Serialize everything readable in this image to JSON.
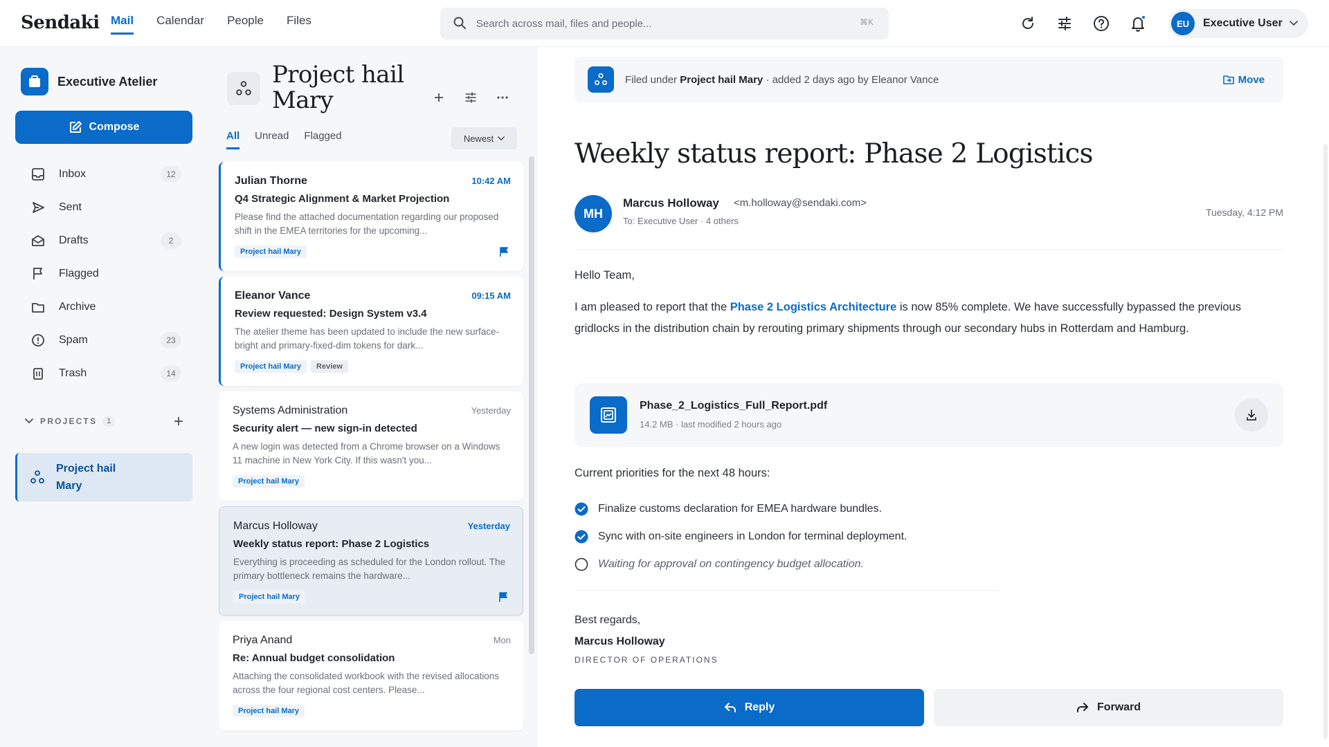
{
  "app": {
    "brand": "Sendaki",
    "nav": [
      "Mail",
      "Calendar",
      "People",
      "Files"
    ],
    "search": {
      "placeholder": "Search across mail, files and people...",
      "shortcut": "⌘K"
    },
    "user": {
      "initials": "EU",
      "name": "Executive User"
    }
  },
  "sidebar": {
    "workspace": "Executive Atelier",
    "compose_label": "Compose",
    "folders": [
      {
        "label": "Inbox",
        "count": "12",
        "icon": "inbox-icon"
      },
      {
        "label": "Sent",
        "count": "",
        "icon": "send-icon"
      },
      {
        "label": "Drafts",
        "count": "2",
        "icon": "drafts-icon"
      },
      {
        "label": "Flagged",
        "count": "",
        "icon": "flag-icon"
      },
      {
        "label": "Archive",
        "count": "",
        "icon": "archive-icon"
      },
      {
        "label": "Spam",
        "count": "23",
        "icon": "spam-icon"
      },
      {
        "label": "Trash",
        "count": "14",
        "icon": "trash-icon"
      }
    ],
    "projects_label": "PROJECTS",
    "projects_count": "1",
    "projects": [
      {
        "label": "Project hail Mary"
      }
    ]
  },
  "list": {
    "title": "Project hail Mary",
    "tabs": [
      "All",
      "Unread",
      "Flagged"
    ],
    "sort_label": "Newest",
    "cards": [
      {
        "sender": "Julian Thorne",
        "time": "10:42 AM",
        "subject": "Q4 Strategic Alignment & Market Projection",
        "preview": "Please find the attached documentation regarding our proposed shift in the EMEA territories for the upcoming...",
        "tags": [
          "Project hail Mary"
        ],
        "flagged": true
      },
      {
        "sender": "Eleanor Vance",
        "time": "09:15 AM",
        "subject": "Review requested: Design System v3.4",
        "preview": "The atelier theme has been updated to include the new surface-bright and primary-fixed-dim tokens for dark...",
        "tags": [
          "Project hail Mary",
          "Review"
        ],
        "flagged": false
      },
      {
        "sender": "Systems Administration",
        "time": "Yesterday",
        "subject": "Security alert — new sign-in detected",
        "preview": "A new login was detected from a Chrome browser on a Windows 11 machine in New York City. If this wasn't you...",
        "tags": [
          "Project hail Mary"
        ],
        "flagged": false
      },
      {
        "sender": "Marcus Holloway",
        "time": "Yesterday",
        "subject": "Weekly status report: Phase 2 Logistics",
        "preview": "Everything is proceeding as scheduled for the London rollout. The primary bottleneck remains the hardware...",
        "tags": [
          "Project hail Mary"
        ],
        "flagged": true
      },
      {
        "sender": "Priya Anand",
        "time": "Mon",
        "subject": "Re: Annual budget consolidation",
        "preview": "Attaching the consolidated workbook with the revised allocations across the four regional cost centers. Please...",
        "tags": [
          "Project hail Mary"
        ],
        "flagged": false
      }
    ]
  },
  "reader": {
    "filed": {
      "prefix": "Filed under",
      "project": "Project hail Mary",
      "suffix": "· added 2 days ago by Eleanor Vance",
      "move_label": "Move"
    },
    "title": "Weekly status report: Phase 2 Logistics",
    "sender": {
      "initials": "MH",
      "name": "Marcus Holloway",
      "email": "<m.holloway@sendaki.com>",
      "to": "To: Executive User · 4 others"
    },
    "date": "Tuesday, 4:12 PM",
    "greeting": "Hello Team,",
    "paragraph": {
      "before": "I am pleased to report that the ",
      "link": "Phase 2 Logistics Architecture",
      "after": " is now 85% complete. We have successfully bypassed the previous gridlocks in the distribution chain by rerouting primary shipments through our secondary hubs in Rotterdam and Hamburg."
    },
    "attachment": {
      "name": "Phase_2_Logistics_Full_Report.pdf",
      "meta": "14.2 MB · last modified 2 hours ago"
    },
    "priorities_heading": "Current priorities for the next 48 hours:",
    "tasks": [
      {
        "label": "Finalize customs declaration for EMEA hardware bundles.",
        "done": true
      },
      {
        "label": "Sync with on-site engineers in London for terminal deployment.",
        "done": true
      },
      {
        "label": "Waiting for approval on contingency budget allocation.",
        "done": false
      }
    ],
    "regards": "Best regards,",
    "signature_name": "Marcus Holloway",
    "signature_role": "DIRECTOR OF OPERATIONS",
    "reply_label": "Reply",
    "forward_label": "Forward"
  },
  "colors": {
    "accent": "#0a6bc8",
    "sidebar_bg": "#f6f7f8"
  }
}
